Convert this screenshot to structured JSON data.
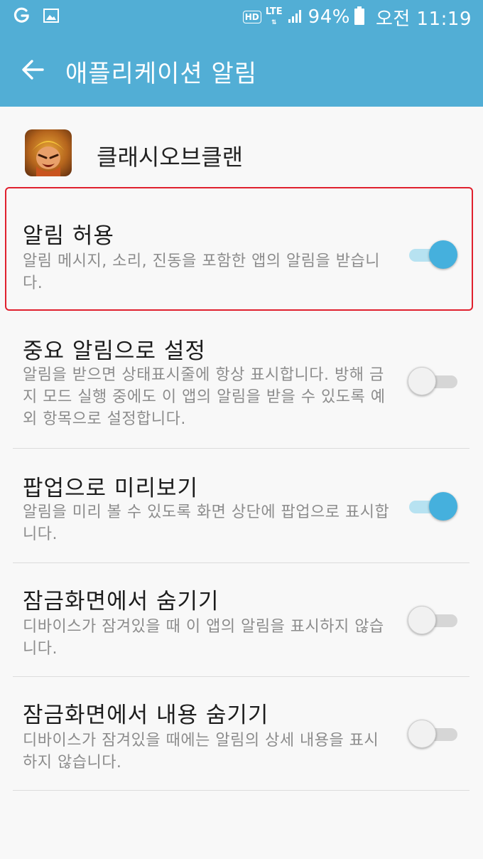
{
  "statusbar": {
    "hd": "HD",
    "network": "LTE",
    "battery": "94%",
    "time": "오전 11:19",
    "icons": [
      "carrier-g-icon",
      "gallery-icon",
      "signal-icon",
      "battery-icon"
    ]
  },
  "appbar": {
    "title": "애플리케이션 알림",
    "back_icon": "back-arrow-icon"
  },
  "app": {
    "name": "클래시오브클랜",
    "icon": "app-icon-clash"
  },
  "settings": [
    {
      "title": "알림 허용",
      "desc": "알림 메시지, 소리, 진동을 포함한 앱의 알림을 받습니다.",
      "on": true
    },
    {
      "title": "중요 알림으로 설정",
      "desc": "알림을 받으면 상태표시줄에 항상 표시합니다. 방해 금지 모드 실행 중에도 이 앱의 알림을 받을 수 있도록 예외 항목으로 설정합니다.",
      "on": false
    },
    {
      "title": "팝업으로 미리보기",
      "desc": "알림을 미리 볼 수 있도록 화면 상단에 팝업으로 표시합니다.",
      "on": true
    },
    {
      "title": "잠금화면에서 숨기기",
      "desc": "디바이스가 잠겨있을 때 이 앱의 알림을 표시하지 않습니다.",
      "on": false
    },
    {
      "title": "잠금화면에서 내용 숨기기",
      "desc": "디바이스가 잠겨있을 때에는 알림의 상세 내용을 표시하지 않습니다.",
      "on": false
    }
  ],
  "colors": {
    "primary": "#52aed5",
    "switch_on": "#45b0dd",
    "highlight": "#e0202e"
  }
}
